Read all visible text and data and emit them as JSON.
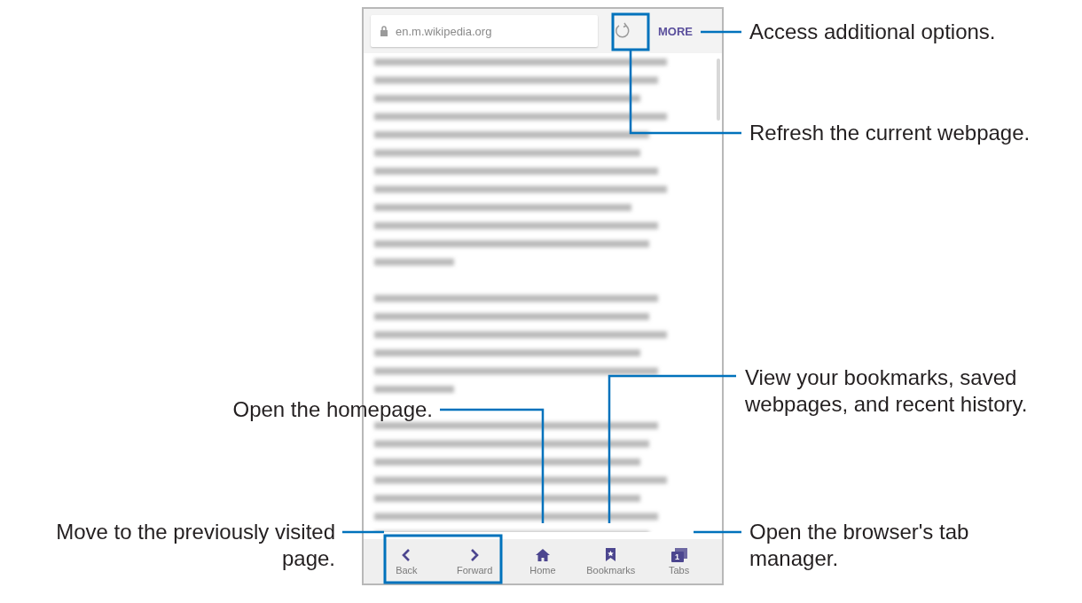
{
  "address_bar": {
    "url": "en.m.wikipedia.org",
    "more_label": "MORE"
  },
  "toolbar": [
    {
      "kind": "back",
      "label": "Back"
    },
    {
      "kind": "forward",
      "label": "Forward"
    },
    {
      "kind": "home",
      "label": "Home"
    },
    {
      "kind": "bookmarks",
      "label": "Bookmarks"
    },
    {
      "kind": "tabs",
      "label": "Tabs",
      "count": "1"
    }
  ],
  "callouts": [
    {
      "kind": "more",
      "lines": [
        "Access additional options."
      ]
    },
    {
      "kind": "refresh",
      "lines": [
        "Refresh the current webpage."
      ]
    },
    {
      "kind": "home",
      "lines": [
        "Open the homepage."
      ]
    },
    {
      "kind": "bookmarks",
      "lines": [
        "View your bookmarks, saved",
        "webpages, and recent history."
      ]
    },
    {
      "kind": "back_forward",
      "lines": [
        "Move to the previously visited",
        "page."
      ]
    },
    {
      "kind": "tabs",
      "lines": [
        "Open the browser's tab",
        "manager."
      ]
    }
  ]
}
